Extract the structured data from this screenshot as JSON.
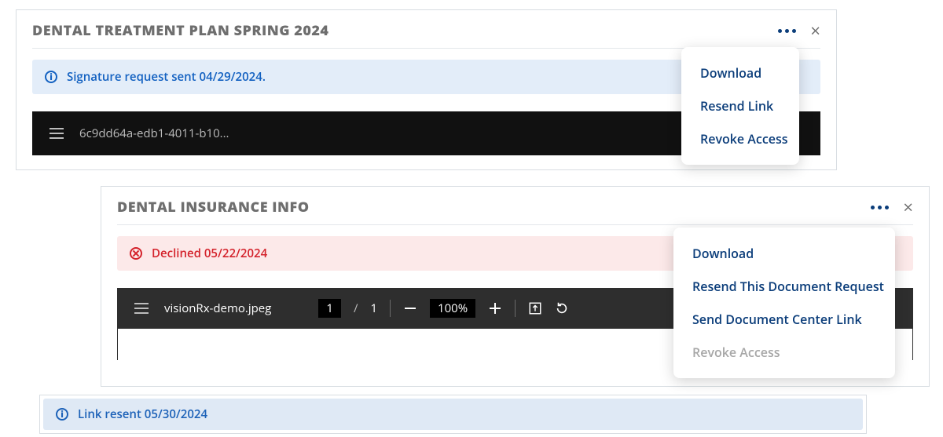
{
  "cards": {
    "treatmentPlan": {
      "title": "DENTAL TREATMENT PLAN SPRING 2024",
      "alert": {
        "text": "Signature request sent 04/29/2024."
      },
      "docId": "6c9dd64a-edb1-4011-b10...",
      "popover": {
        "items": [
          {
            "label": "Download",
            "enabled": true
          },
          {
            "label": "Resend Link",
            "enabled": true
          },
          {
            "label": "Revoke Access",
            "enabled": true
          }
        ]
      }
    },
    "insuranceInfo": {
      "title": "DENTAL INSURANCE INFO",
      "alert": {
        "text": "Declined 05/22/2024"
      },
      "docName": "visionRx-demo.jpeg",
      "pageBox": "1",
      "pageSlash": "/",
      "pageTotal": "1",
      "zoom": "100%",
      "popover": {
        "items": [
          {
            "label": "Download",
            "enabled": true
          },
          {
            "label": "Resend This Document Request",
            "enabled": true
          },
          {
            "label": "Send Document Center Link",
            "enabled": true
          },
          {
            "label": "Revoke Access",
            "enabled": false
          }
        ]
      }
    }
  },
  "bottomAlert": {
    "text": "Link resent 05/30/2024"
  }
}
